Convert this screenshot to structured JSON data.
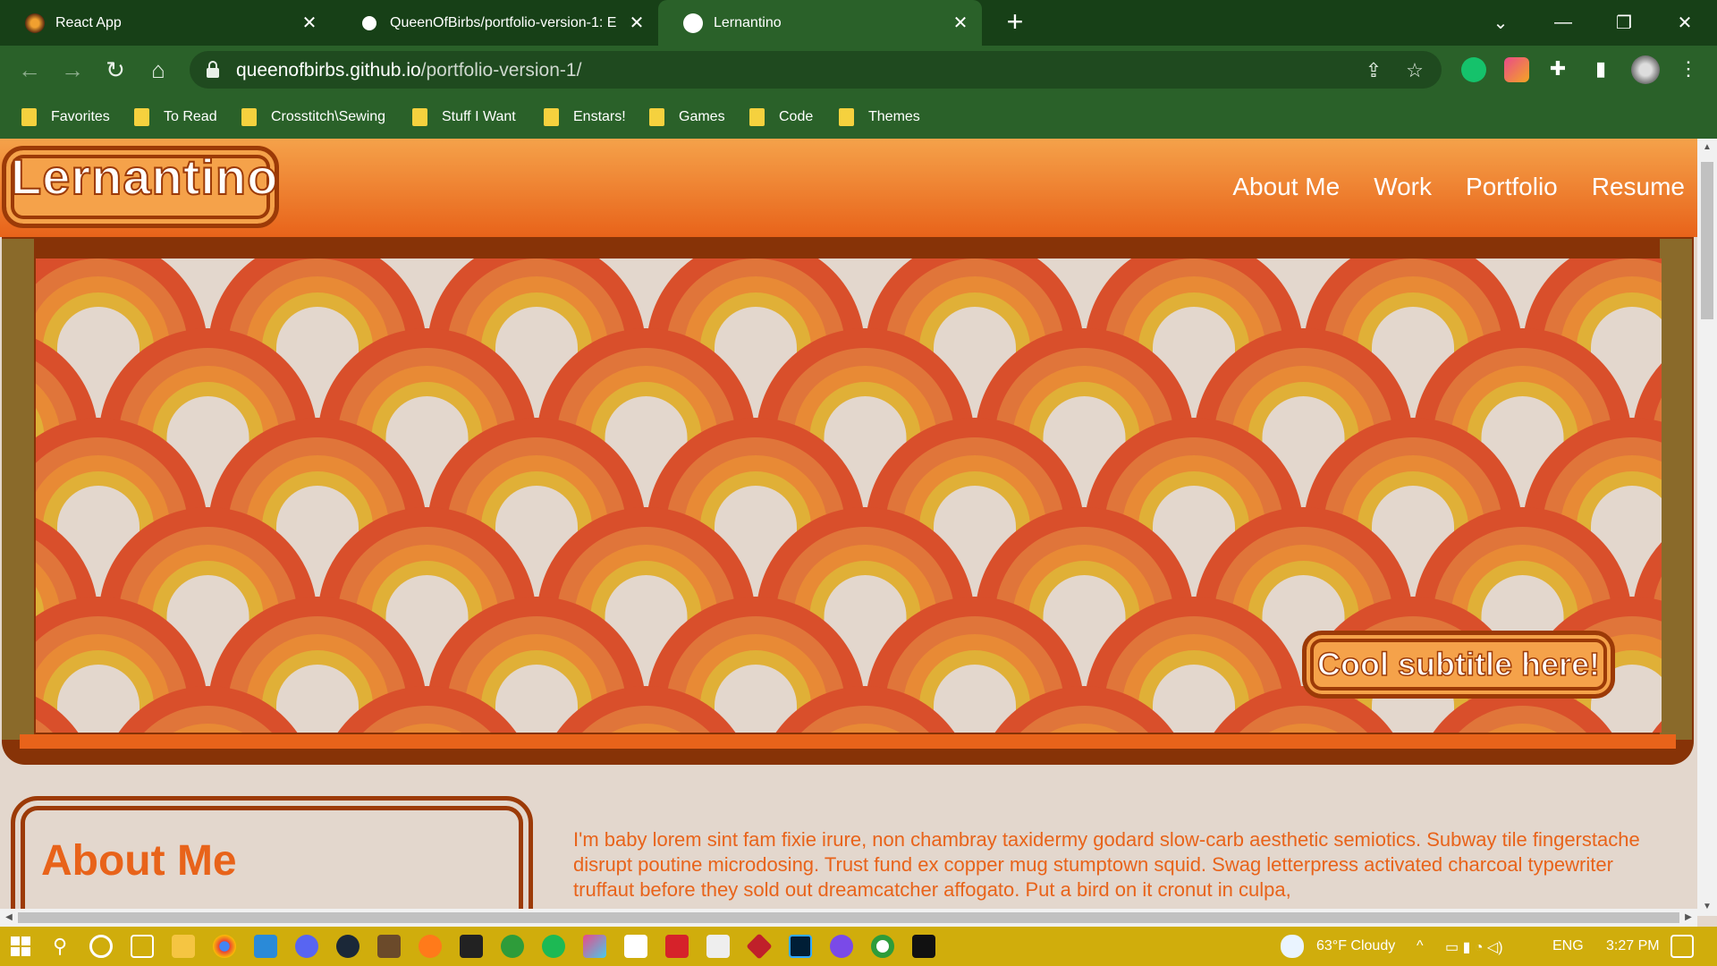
{
  "browser": {
    "tabs": [
      {
        "title": "React App",
        "active": false,
        "icon": "react-favicon"
      },
      {
        "title": "QueenOfBirbs/portfolio-version-1: E",
        "active": false,
        "icon": "github-favicon"
      },
      {
        "title": "Lernantino",
        "active": true,
        "icon": "globe-favicon"
      }
    ],
    "url_host": "queenofbirbs.github.io",
    "url_path": "/portfolio-version-1/",
    "bookmarks": [
      "Favorites",
      "To Read",
      "Crosstitch\\Sewing",
      "Stuff I Want",
      "Enstars!",
      "Games",
      "Code",
      "Themes"
    ]
  },
  "site": {
    "logo": "Lernantino",
    "nav": [
      "About Me",
      "Work",
      "Portfolio",
      "Resume"
    ],
    "subtitle": "Cool subtitle here!",
    "about_title": "About Me",
    "about_text": "I'm baby lorem sint fam fixie irure, non chambray taxidermy godard slow-carb aesthetic semiotics. Subway tile fingerstache disrupt poutine microdosing. Trust fund ex copper mug stumptown squid. Swag letterpress activated charcoal typewriter truffaut before they sold out dreamcatcher affogato. Put a bird on it cronut in culpa,"
  },
  "taskbar": {
    "weather": "63°F  Cloudy",
    "language": "ENG",
    "time": "3:27 PM"
  },
  "colors": {
    "chrome_dark": "#174017",
    "chrome": "#2a6129",
    "orange": "#e8631a",
    "brown": "#9c3a07",
    "cream": "#e3d7cd",
    "taskbar": "#d0ad0c"
  }
}
